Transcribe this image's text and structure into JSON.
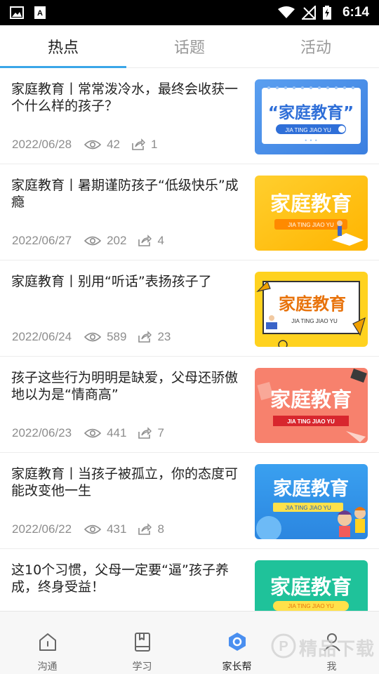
{
  "status_bar": {
    "time": "6:14"
  },
  "tabs": [
    {
      "label": "热点",
      "active": true
    },
    {
      "label": "话题",
      "active": false
    },
    {
      "label": "活动",
      "active": false
    }
  ],
  "articles": [
    {
      "title": "家庭教育丨常常泼冷水，最终会收获一个什么样的孩子？",
      "date": "2022/06/28",
      "views": "42",
      "shares": "1",
      "thumb": {
        "heading": "“家庭教育”",
        "pinyin": "JIA TING JIAO YU"
      }
    },
    {
      "title": "家庭教育丨暑期谨防孩子“低级快乐”成瘾",
      "date": "2022/06/27",
      "views": "202",
      "shares": "4",
      "thumb": {
        "heading": "家庭教育",
        "pinyin": "JIA TING JIAO YU"
      }
    },
    {
      "title": "家庭教育丨别用“听话”表扬孩子了",
      "date": "2022/06/24",
      "views": "589",
      "shares": "23",
      "thumb": {
        "heading": "家庭教育",
        "pinyin": "JIA TING JIAO YU"
      }
    },
    {
      "title": "孩子这些行为明明是缺爱，父母还骄傲地以为是“情商高”",
      "date": "2022/06/23",
      "views": "441",
      "shares": "7",
      "thumb": {
        "heading": "家庭教育",
        "pinyin": "JIA TING JIAO YU"
      }
    },
    {
      "title": "家庭教育丨当孩子被孤立，你的态度可能改变他一生",
      "date": "2022/06/22",
      "views": "431",
      "shares": "8",
      "thumb": {
        "heading": "家庭教育",
        "pinyin": "JIA TING JIAO YU"
      }
    },
    {
      "title": "这10个习惯，父母一定要“逼”孩子养成，终身受益！",
      "date": "",
      "views": "",
      "shares": "",
      "thumb": {
        "heading": "家庭教育",
        "pinyin": "JIA TING JIAO YU"
      }
    }
  ],
  "bottom_nav": [
    {
      "label": "沟通",
      "icon": "home-icon",
      "active": false
    },
    {
      "label": "学习",
      "icon": "book-icon",
      "active": false
    },
    {
      "label": "家长帮",
      "icon": "hexagon-icon",
      "active": true
    },
    {
      "label": "我",
      "icon": "person-icon",
      "active": false
    }
  ],
  "watermark": {
    "text": "精品下载"
  },
  "colors": {
    "accent": "#3aa6e8",
    "text": "#222222",
    "meta": "#8d8d8d"
  }
}
